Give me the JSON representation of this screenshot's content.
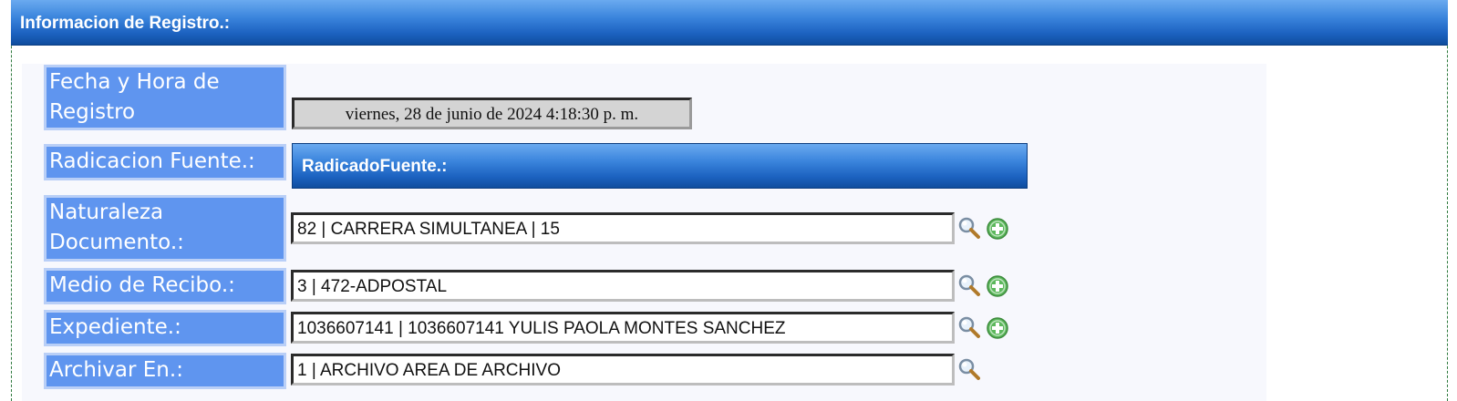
{
  "header": {
    "title": "Informacion de Registro.:"
  },
  "form": {
    "fecha": {
      "label": "Fecha y Hora de Registro",
      "value": "viernes, 28 de junio de 2024 4:18:30 p. m."
    },
    "radicacion": {
      "label": "Radicacion Fuente.:",
      "section_title": "RadicadoFuente.:"
    },
    "naturaleza": {
      "label": "Naturaleza Documento.:",
      "value": "82 | CARRERA SIMULTANEA | 15"
    },
    "medio": {
      "label": "Medio de Recibo.:",
      "value": "3 | 472-ADPOSTAL"
    },
    "expediente": {
      "label": "Expediente.:",
      "value": "1036607141 | 1036607141 YULIS PAOLA MONTES SANCHEZ"
    },
    "archivar": {
      "label": "Archivar En.:",
      "value": "1 | ARCHIVO AREA DE ARCHIVO"
    }
  },
  "icons": {
    "search": "search-icon",
    "add": "add-icon"
  },
  "colors": {
    "label_bg": "#5f95ef",
    "header_blue": "#1c62c0",
    "panel_bg": "#f7f8fd",
    "add_green": "#4caf50"
  }
}
